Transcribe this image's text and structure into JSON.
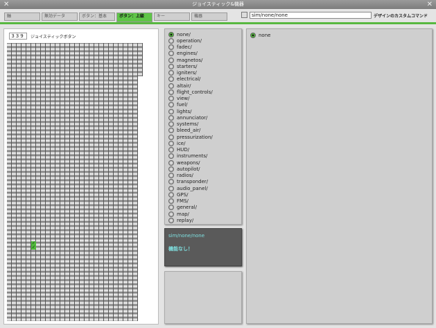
{
  "window": {
    "title": "ジョイスティック&機器"
  },
  "tabs": [
    {
      "label": "軸"
    },
    {
      "label": "無効データ"
    },
    {
      "label": "ボタン：基本"
    },
    {
      "label": "ボタン：上級",
      "active": true
    },
    {
      "label": "キー"
    },
    {
      "label": "機器"
    }
  ],
  "command": {
    "value": "sim/none/none",
    "label": "デザインのカスタムコマンド",
    "checked": false
  },
  "buttons": {
    "count": "339",
    "label": "ジョイスティックボタン"
  },
  "categories": [
    "none/",
    "operation/",
    "fadec/",
    "engines/",
    "magnetos/",
    "starters/",
    "igniters/",
    "electrical/",
    "altair/",
    "flight_controls/",
    "view/",
    "fuel/",
    "lights/",
    "annunciator/",
    "systems/",
    "bleed_air/",
    "pressurization/",
    "ice/",
    "HUD/",
    "instruments/",
    "weapons/",
    "autopilot/",
    "radios/",
    "transponder/",
    "audio_panel/",
    "GPS/",
    "FMS/",
    "general/",
    "map/",
    "replay/"
  ],
  "selected_category": "none/",
  "commands": [
    {
      "label": "none",
      "selected": true
    }
  ],
  "info": {
    "command": "sim/none/none",
    "message": "機能なし！"
  },
  "colors": {
    "accent": "#5fc548",
    "info_bg": "#5a5a5a",
    "info_text": "#7fe0e0"
  }
}
